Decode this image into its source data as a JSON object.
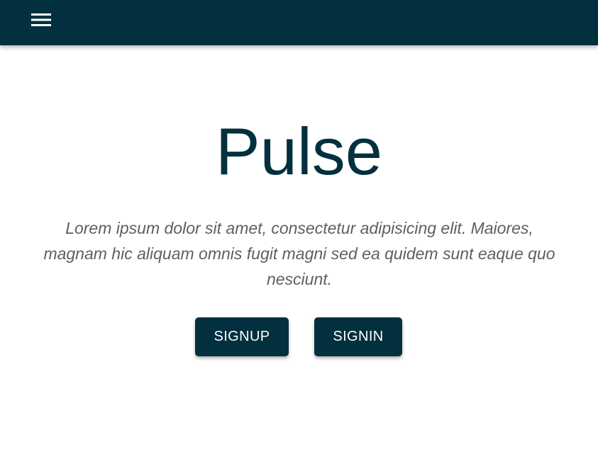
{
  "navbar": {
    "menu_icon": "hamburger-menu-icon",
    "color": "#03303f"
  },
  "hero": {
    "title": "Pulse",
    "description": "Lorem ipsum dolor sit amet, consectetur adipisicing elit. Maiores, magnam hic aliquam omnis fugit magni sed ea quidem sunt eaque quo nesciunt."
  },
  "actions": {
    "signup_label": "SIGNUP",
    "signin_label": "SIGNIN"
  }
}
